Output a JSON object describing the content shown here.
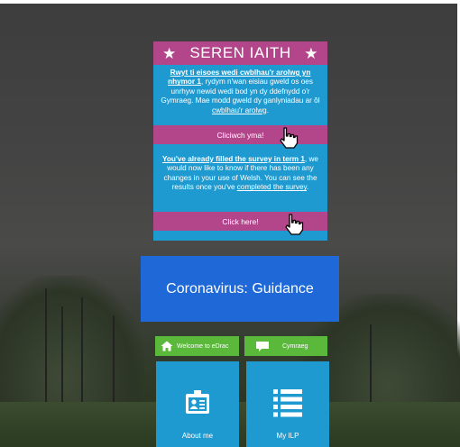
{
  "seren": {
    "title": "SEREN IAITH",
    "welsh_bold": "Rwyt ti eisoes wedi cwblhau'r arolwg yn nhymor 1",
    "welsh_rest": ", rydym n'wan eisiau gweld os oes unrhyw newid wedi bod yn dy ddefnydd o'r Gymraeg. Mae modd gweld dy ganlyniadau ar ôl ",
    "welsh_link": "cwblhau'r arolwg",
    "welsh_end": ".",
    "welsh_cta": "Cliciwch yma!",
    "english_bold": "You've already filled the survey in term 1",
    "english_rest": ", we would now like to know if there has been any changes in your use of Welsh. You can see the results once you've ",
    "english_link": "completed the survey",
    "english_end": ".",
    "english_cta": "Click here!"
  },
  "corona": {
    "label": "Coronavirus: Guidance"
  },
  "buttons": {
    "welcome": "Welcome to eDrac",
    "cymraeg": "Cymraeg"
  },
  "tiles": {
    "about": "About me",
    "ilp": "My ILP"
  },
  "colors": {
    "accent_blue": "#1e9ad0",
    "corona_blue": "#1e68d8",
    "magenta": "#b3458a",
    "green": "#5ab93a"
  }
}
